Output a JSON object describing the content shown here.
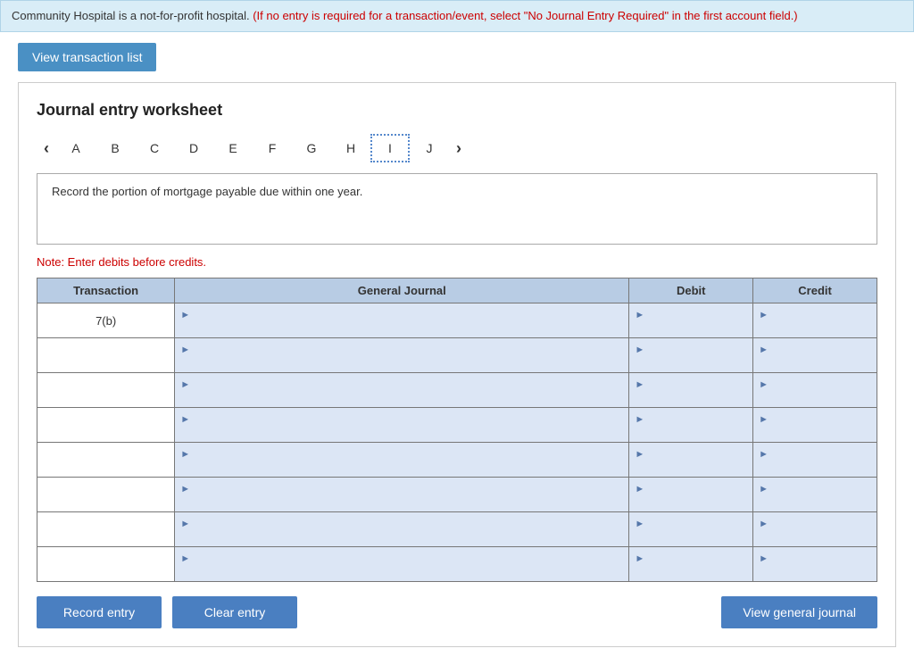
{
  "banner": {
    "text": "Community Hospital is a not-for-profit hospital. ",
    "red_text": "(If no entry is required for a transaction/event, select \"No Journal Entry Required\" in the first account field.)"
  },
  "top_button": {
    "label": "View transaction list"
  },
  "worksheet": {
    "title": "Journal entry worksheet",
    "columns": [
      "A",
      "B",
      "C",
      "D",
      "E",
      "F",
      "G",
      "H",
      "I",
      "J"
    ],
    "active_column": "I",
    "description": "Record the portion of mortgage payable due within one year.",
    "note": "Note: Enter debits before credits.",
    "table": {
      "headers": [
        "Transaction",
        "General Journal",
        "Debit",
        "Credit"
      ],
      "transaction_label": "7(b)",
      "rows": 8
    },
    "buttons": {
      "record": "Record entry",
      "clear": "Clear entry",
      "view_journal": "View general journal"
    }
  }
}
